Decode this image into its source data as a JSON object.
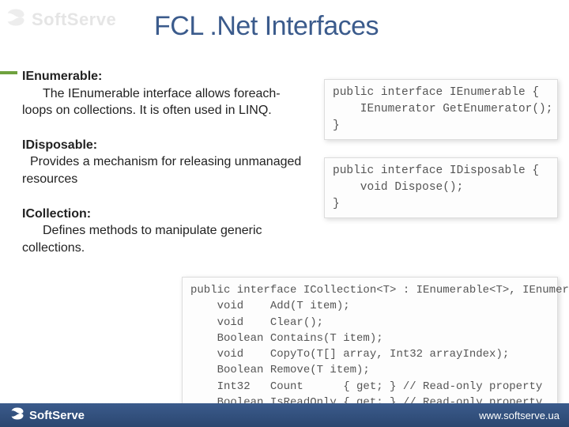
{
  "watermark": {
    "brand": "SoftServe"
  },
  "title": "FCL .Net Interfaces",
  "sections": [
    {
      "heading": "IEnumerable:",
      "desc": "The IEnumerable interface allows foreach-loops on collections. It is often used in LINQ."
    },
    {
      "heading": "IDisposable:",
      "desc": "Provides a mechanism for releasing unmanaged resources"
    },
    {
      "heading": "ICollection:",
      "desc": "Defines methods to manipulate generic collections."
    }
  ],
  "code": {
    "ienumerable": "public interface IEnumerable {\n    IEnumerator GetEnumerator();\n}",
    "idisposable": "public interface IDisposable {\n    void Dispose();\n}",
    "icollection": "public interface ICollection<T> : IEnumerable<T>, IEnumerable {\n    void    Add(T item);\n    void    Clear();\n    Boolean Contains(T item);\n    void    CopyTo(T[] array, Int32 arrayIndex);\n    Boolean Remove(T item);\n    Int32   Count      { get; } // Read-only property\n    Boolean IsReadOnly { get; } // Read-only property\n}"
  },
  "footer": {
    "brand": "SoftServe",
    "url": "www.softserve.ua"
  }
}
